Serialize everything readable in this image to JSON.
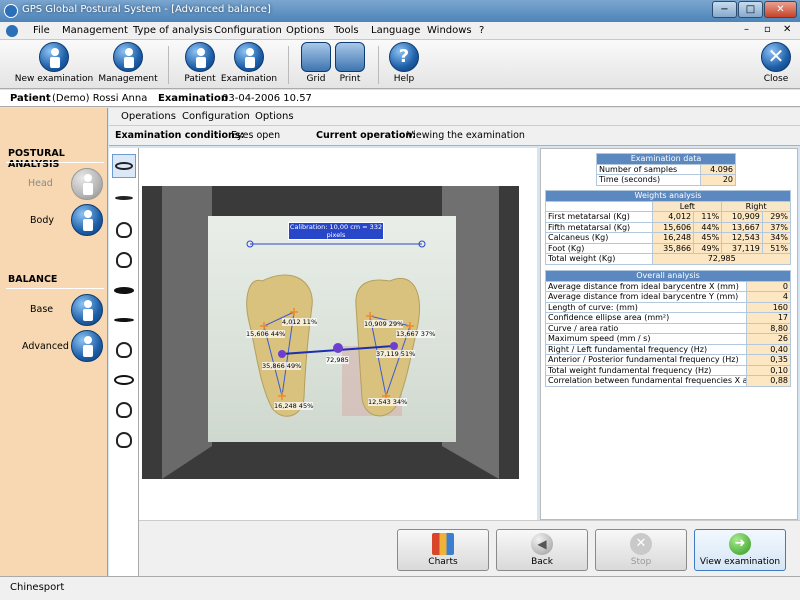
{
  "window": {
    "title": "GPS Global Postural System - [Advanced balance]",
    "minimize": "−",
    "maximize": "□",
    "close": "✕"
  },
  "menu": [
    "File",
    "Management",
    "Type of analysis",
    "Configuration",
    "Options",
    "Tools",
    "Language",
    "Windows",
    "?"
  ],
  "mdi_controls": {
    "min": "–",
    "restore": "▫",
    "close": "✕"
  },
  "toolbar": {
    "new_exam": "New examination",
    "management": "Management",
    "patient": "Patient",
    "examination": "Examination",
    "grid": "Grid",
    "print": "Print",
    "help": "Help",
    "close": "Close"
  },
  "patient_bar": {
    "patient_label": "Patient",
    "patient_value": "(Demo) Rossi Anna",
    "exam_label": "Examination",
    "exam_value": "03-04-2006 10.57"
  },
  "left_panel": {
    "postural_title": "POSTURAL ANALYSIS",
    "head": "Head",
    "body": "Body",
    "balance_title": "BALANCE",
    "base": "Base",
    "advanced": "Advanced"
  },
  "submenu": [
    "Operations",
    "Configuration",
    "Options"
  ],
  "conditions": {
    "label": "Examination conditions:",
    "value": "Eyes open",
    "op_label": "Current operation:",
    "op_value": "Viewing the examination"
  },
  "calibration": "Calibration: 10,00 cm = 332 pixels",
  "overlay_labels": [
    "4,012 11%",
    "15,606 44%",
    "35,866 49%",
    "16,248 45%",
    "10,909 29%",
    "13,667 37%",
    "37,119 51%",
    "12,543 34%",
    "72,985"
  ],
  "exam_data": {
    "title": "Examination data",
    "rows": [
      {
        "label": "Number of samples",
        "value": "4.096"
      },
      {
        "label": "Time (seconds)",
        "value": "20"
      }
    ]
  },
  "weights": {
    "title": "Weights analysis",
    "left": "Left",
    "right": "Right",
    "rows": [
      {
        "label": "First metatarsal (Kg)",
        "l": "4,012",
        "lp": "11%",
        "r": "10,909",
        "rp": "29%"
      },
      {
        "label": "Fifth metatarsal (Kg)",
        "l": "15,606",
        "lp": "44%",
        "r": "13,667",
        "rp": "37%"
      },
      {
        "label": "Calcaneus (Kg)",
        "l": "16,248",
        "lp": "45%",
        "r": "12,543",
        "rp": "34%"
      },
      {
        "label": "Foot (Kg)",
        "l": "35,866",
        "lp": "49%",
        "r": "37,119",
        "rp": "51%"
      }
    ],
    "total_label": "Total weight (Kg)",
    "total_value": "72,985"
  },
  "overall": {
    "title": "Overall analysis",
    "rows": [
      {
        "label": "Average distance from ideal barycentre X (mm)",
        "value": "0"
      },
      {
        "label": "Average distance from ideal barycentre Y (mm)",
        "value": "4"
      },
      {
        "label": "Length of curve: (mm)",
        "value": "160"
      },
      {
        "label": "Confidence ellipse area (mm²)",
        "value": "17"
      },
      {
        "label": "Curve / area ratio",
        "value": "8,80"
      },
      {
        "label": "Maximum speed (mm / s)",
        "value": "26"
      },
      {
        "label": "Right / Left  fundamental frequency (Hz)",
        "value": "0,40"
      },
      {
        "label": "Anterior / Posterior fundamental frequency (Hz)",
        "value": "0,35"
      },
      {
        "label": "Total weight fundamental frequency (Hz)",
        "value": "0,10"
      },
      {
        "label": "Correlation between fundamental frequencies X and",
        "value": "0,88"
      }
    ]
  },
  "bottom_buttons": {
    "charts": "Charts",
    "back": "Back",
    "stop": "Stop",
    "view": "View examination"
  },
  "status": "Chinesport"
}
